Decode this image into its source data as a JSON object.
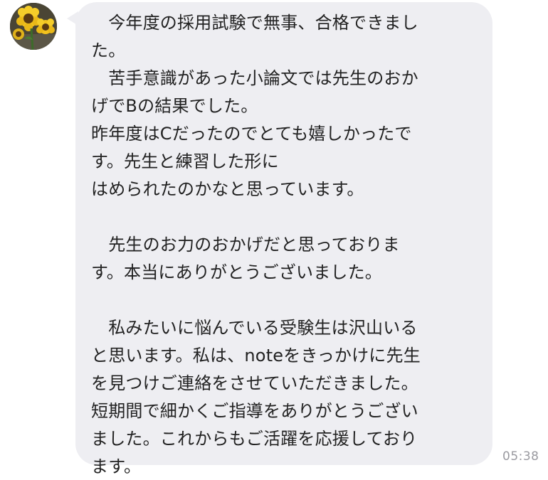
{
  "message": {
    "lines": [
      "　今年度の採用試験で無事、合格できまし",
      "た。",
      "　苦手意識があった小論文では先生のおか",
      "げでBの結果でした。",
      "昨年度はCだったのでとても嬉しかったで",
      "す。先生と練習した形に",
      "はめられたのかなと思っています。",
      "",
      "　先生のお力のおかげだと思っておりま",
      "す。本当にありがとうございました。",
      "",
      "　私みたいに悩んでいる受験生は沢山いる",
      "と思います。私は、noteをきっかけに先生",
      "を見つけご連絡をさせていただきました。",
      "短期間で細かくご指導をありがとうござい",
      "ました。これからもご活躍を応援しており",
      "ます。"
    ],
    "timestamp": "05:38"
  },
  "sender": {
    "avatar_icon": "sunflower-avatar"
  },
  "colors": {
    "bubble": "#eeeef2",
    "text": "#222222",
    "timestamp": "#9a9aa0"
  }
}
